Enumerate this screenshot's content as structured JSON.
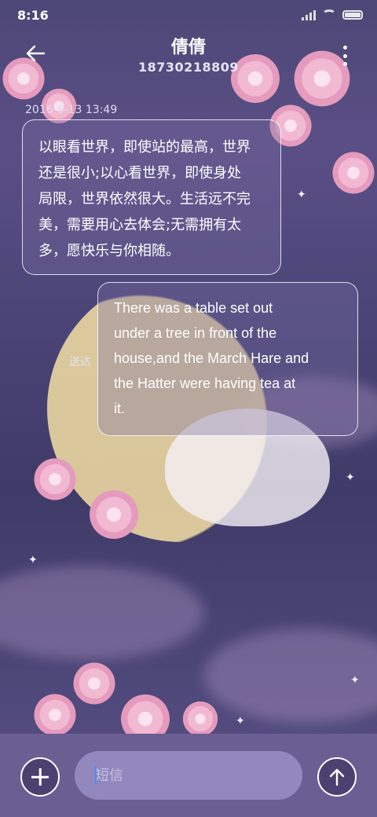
{
  "status_bar": {
    "time": "8:16"
  },
  "header": {
    "contact_name": "倩倩",
    "contact_number": "18730218809"
  },
  "messages": {
    "timestamp": "2016-6-13 13:49",
    "received": {
      "lines": [
        "以眼看世界，即使站的最高，世界",
        "还是很小;以心看世界，即使身处",
        "局限，世界依然很大。生活远不完",
        "美，需要用心去体会;无需拥有太",
        "多，愿快乐与你相随。"
      ]
    },
    "sent": {
      "status": "送达",
      "lines": [
        "There was a table set out",
        "under a tree in front of the",
        "house,and the March Hare and",
        "the Hatter were having tea at",
        "it."
      ]
    }
  },
  "composer": {
    "placeholder": "短信"
  },
  "colors": {
    "bottom_bar": "#6b5e92",
    "input_bg": "#9288bd",
    "background": "#4d4777"
  }
}
